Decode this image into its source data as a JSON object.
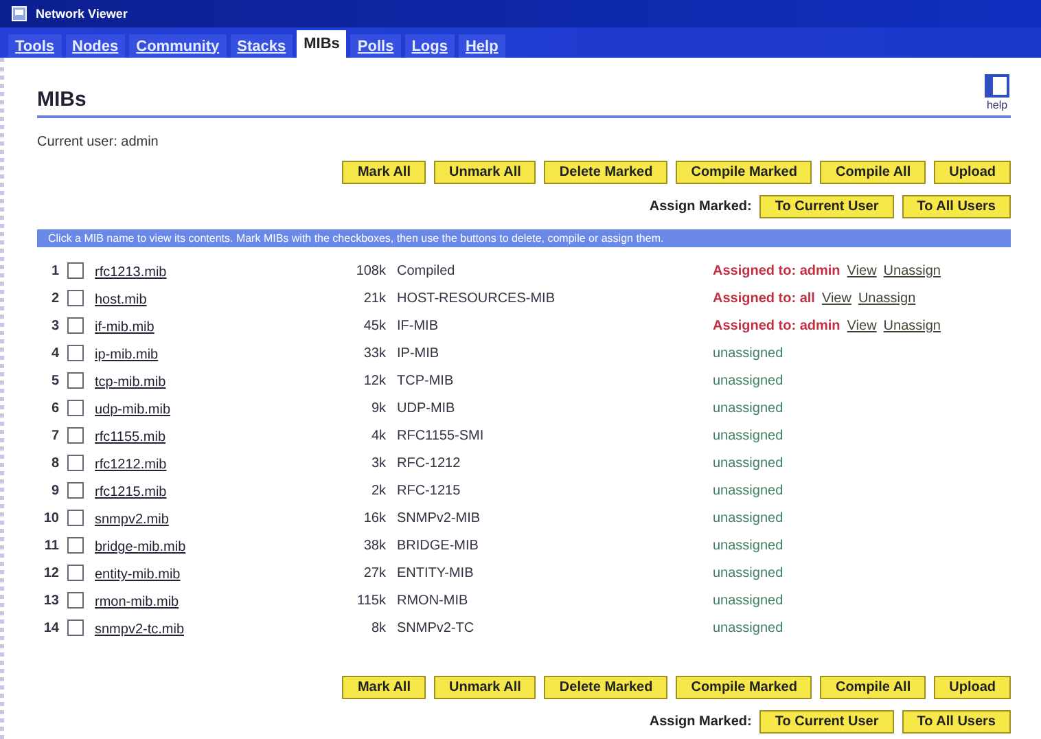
{
  "window": {
    "title": "Network Viewer"
  },
  "tabs": [
    {
      "label": "Tools",
      "selected": false
    },
    {
      "label": "Nodes",
      "selected": false
    },
    {
      "label": "Community",
      "selected": false
    },
    {
      "label": "Stacks",
      "selected": false
    },
    {
      "label": "MIBs",
      "selected": true
    },
    {
      "label": "Polls",
      "selected": false
    },
    {
      "label": "Logs",
      "selected": false
    },
    {
      "label": "Help",
      "selected": false
    }
  ],
  "page": {
    "title": "MIBs",
    "help": "help",
    "current_user": "Current user: admin"
  },
  "toolbars": [
    {
      "actions": [
        "Mark All",
        "Unmark All",
        "Delete Marked",
        "Compile Marked",
        "Compile All",
        "Upload"
      ],
      "assign": {
        "label": "Assign Marked:",
        "buttons": [
          "To Current User",
          "To All Users"
        ]
      }
    },
    {
      "actions": [
        "Mark All",
        "Unmark All",
        "Delete Marked",
        "Compile Marked",
        "Compile All",
        "Upload"
      ],
      "assign": {
        "label": "Assign Marked:",
        "buttons": [
          "To Current User",
          "To All Users"
        ]
      }
    }
  ],
  "info_bar": "Click a MIB name to view its contents. Mark MIBs with the checkboxes, then use the buttons to delete, compile or assign them.",
  "rows": [
    {
      "index": "1",
      "checked": false,
      "file": "rfc1213.mib",
      "size": "108k",
      "description": "Compiled",
      "assigned": true,
      "status": "Assigned to: admin",
      "links": [
        "View",
        "Unassign"
      ]
    },
    {
      "index": "2",
      "checked": false,
      "file": "host.mib",
      "size": "21k",
      "description": "HOST-RESOURCES-MIB",
      "assigned": true,
      "status": "Assigned to: all",
      "links": [
        "View",
        "Unassign"
      ]
    },
    {
      "index": "3",
      "checked": false,
      "file": "if-mib.mib",
      "size": "45k",
      "description": "IF-MIB",
      "assigned": true,
      "status": "Assigned to: admin",
      "links": [
        "View",
        "Unassign"
      ]
    },
    {
      "index": "4",
      "checked": false,
      "file": "ip-mib.mib",
      "size": "33k",
      "description": "IP-MIB",
      "assigned": false,
      "status": "unassigned",
      "links": []
    },
    {
      "index": "5",
      "checked": false,
      "file": "tcp-mib.mib",
      "size": "12k",
      "description": "TCP-MIB",
      "assigned": false,
      "status": "unassigned",
      "links": []
    },
    {
      "index": "6",
      "checked": false,
      "file": "udp-mib.mib",
      "size": "9k",
      "description": "UDP-MIB",
      "assigned": false,
      "status": "unassigned",
      "links": []
    },
    {
      "index": "7",
      "checked": false,
      "file": "rfc1155.mib",
      "size": "4k",
      "description": "RFC1155-SMI",
      "assigned": false,
      "status": "unassigned",
      "links": []
    },
    {
      "index": "8",
      "checked": false,
      "file": "rfc1212.mib",
      "size": "3k",
      "description": "RFC-1212",
      "assigned": false,
      "status": "unassigned",
      "links": []
    },
    {
      "index": "9",
      "checked": false,
      "file": "rfc1215.mib",
      "size": "2k",
      "description": "RFC-1215",
      "assigned": false,
      "status": "unassigned",
      "links": []
    },
    {
      "index": "10",
      "checked": false,
      "file": "snmpv2.mib",
      "size": "16k",
      "description": "SNMPv2-MIB",
      "assigned": false,
      "status": "unassigned",
      "links": []
    },
    {
      "index": "11",
      "checked": false,
      "file": "bridge-mib.mib",
      "size": "38k",
      "description": "BRIDGE-MIB",
      "assigned": false,
      "status": "unassigned",
      "links": []
    },
    {
      "index": "12",
      "checked": false,
      "file": "entity-mib.mib",
      "size": "27k",
      "description": "ENTITY-MIB",
      "assigned": false,
      "status": "unassigned",
      "links": []
    },
    {
      "index": "13",
      "checked": false,
      "file": "rmon-mib.mib",
      "size": "115k",
      "description": "RMON-MIB",
      "assigned": false,
      "status": "unassigned",
      "links": []
    },
    {
      "index": "14",
      "checked": false,
      "file": "snmpv2-tc.mib",
      "size": "8k",
      "description": "SNMPv2-TC",
      "assigned": false,
      "status": "unassigned",
      "links": []
    }
  ]
}
